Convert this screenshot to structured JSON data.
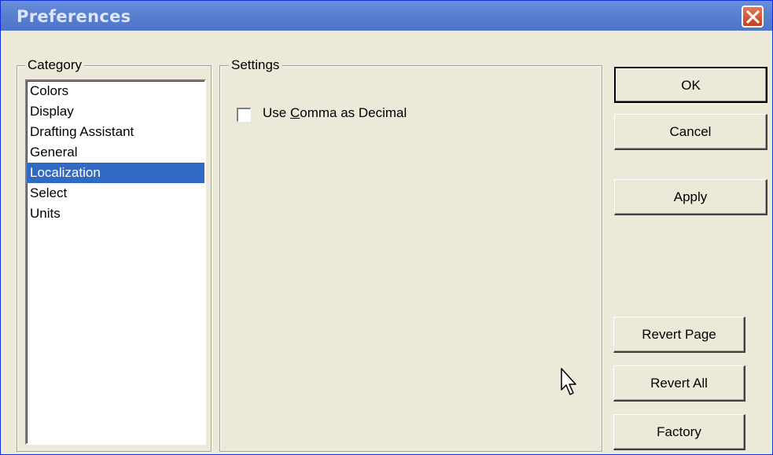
{
  "window": {
    "title": "Preferences"
  },
  "category": {
    "legend": "Category",
    "items": [
      "Colors",
      "Display",
      "Drafting Assistant",
      "General",
      "Localization",
      "Select",
      "Units"
    ],
    "selected_index": 4
  },
  "settings": {
    "legend": "Settings",
    "checkbox_label_pre": "Use ",
    "checkbox_label_mnemonic": "C",
    "checkbox_label_post": "omma as Decimal",
    "checked": false
  },
  "buttons": {
    "ok": "OK",
    "cancel": "Cancel",
    "apply": "Apply",
    "revert_page": "Revert Page",
    "revert_all": "Revert All",
    "factory": "Factory"
  },
  "icons": {
    "close": "close-icon",
    "cursor": "mouse-pointer-icon"
  },
  "colors": {
    "titlebar": "#5a80d2",
    "selection": "#316ac5",
    "close": "#d2542f",
    "dialog_bg": "#ece9d8"
  }
}
